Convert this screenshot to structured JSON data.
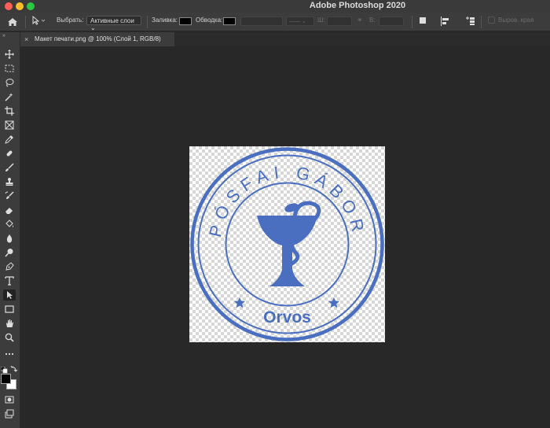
{
  "window": {
    "title": "Adobe Photoshop 2020"
  },
  "options_bar": {
    "select_label": "Выбрать:",
    "select_value": "Активные слои",
    "fill_label": "Заливка:",
    "stroke_label": "Обводка:",
    "w_label": "Ш:",
    "h_label": "В:",
    "align_edges_label": "Выров. края"
  },
  "document_tab": {
    "title": "Макет печати.png @ 100% (Слой 1, RGB/8)"
  },
  "artwork": {
    "top_text": "PÓSFAI GÁBOR",
    "bottom_text": "Orvos",
    "color": "#4a6fc0"
  },
  "colors": {
    "foreground": "#000000",
    "background": "#ffffff",
    "stamp_blue": "#4a6fc0"
  },
  "tools": [
    "move-icon",
    "marquee-icon",
    "lasso-icon",
    "magic-wand-icon",
    "crop-icon",
    "frame-icon",
    "eyedropper-icon",
    "healing-icon",
    "brush-icon",
    "stamp-icon",
    "history-brush-icon",
    "eraser-icon",
    "paint-bucket-icon",
    "blur-icon",
    "dodge-icon",
    "pen-icon",
    "type-icon",
    "path-select-icon",
    "rectangle-icon",
    "hand-icon",
    "zoom-icon",
    "more-icon"
  ]
}
